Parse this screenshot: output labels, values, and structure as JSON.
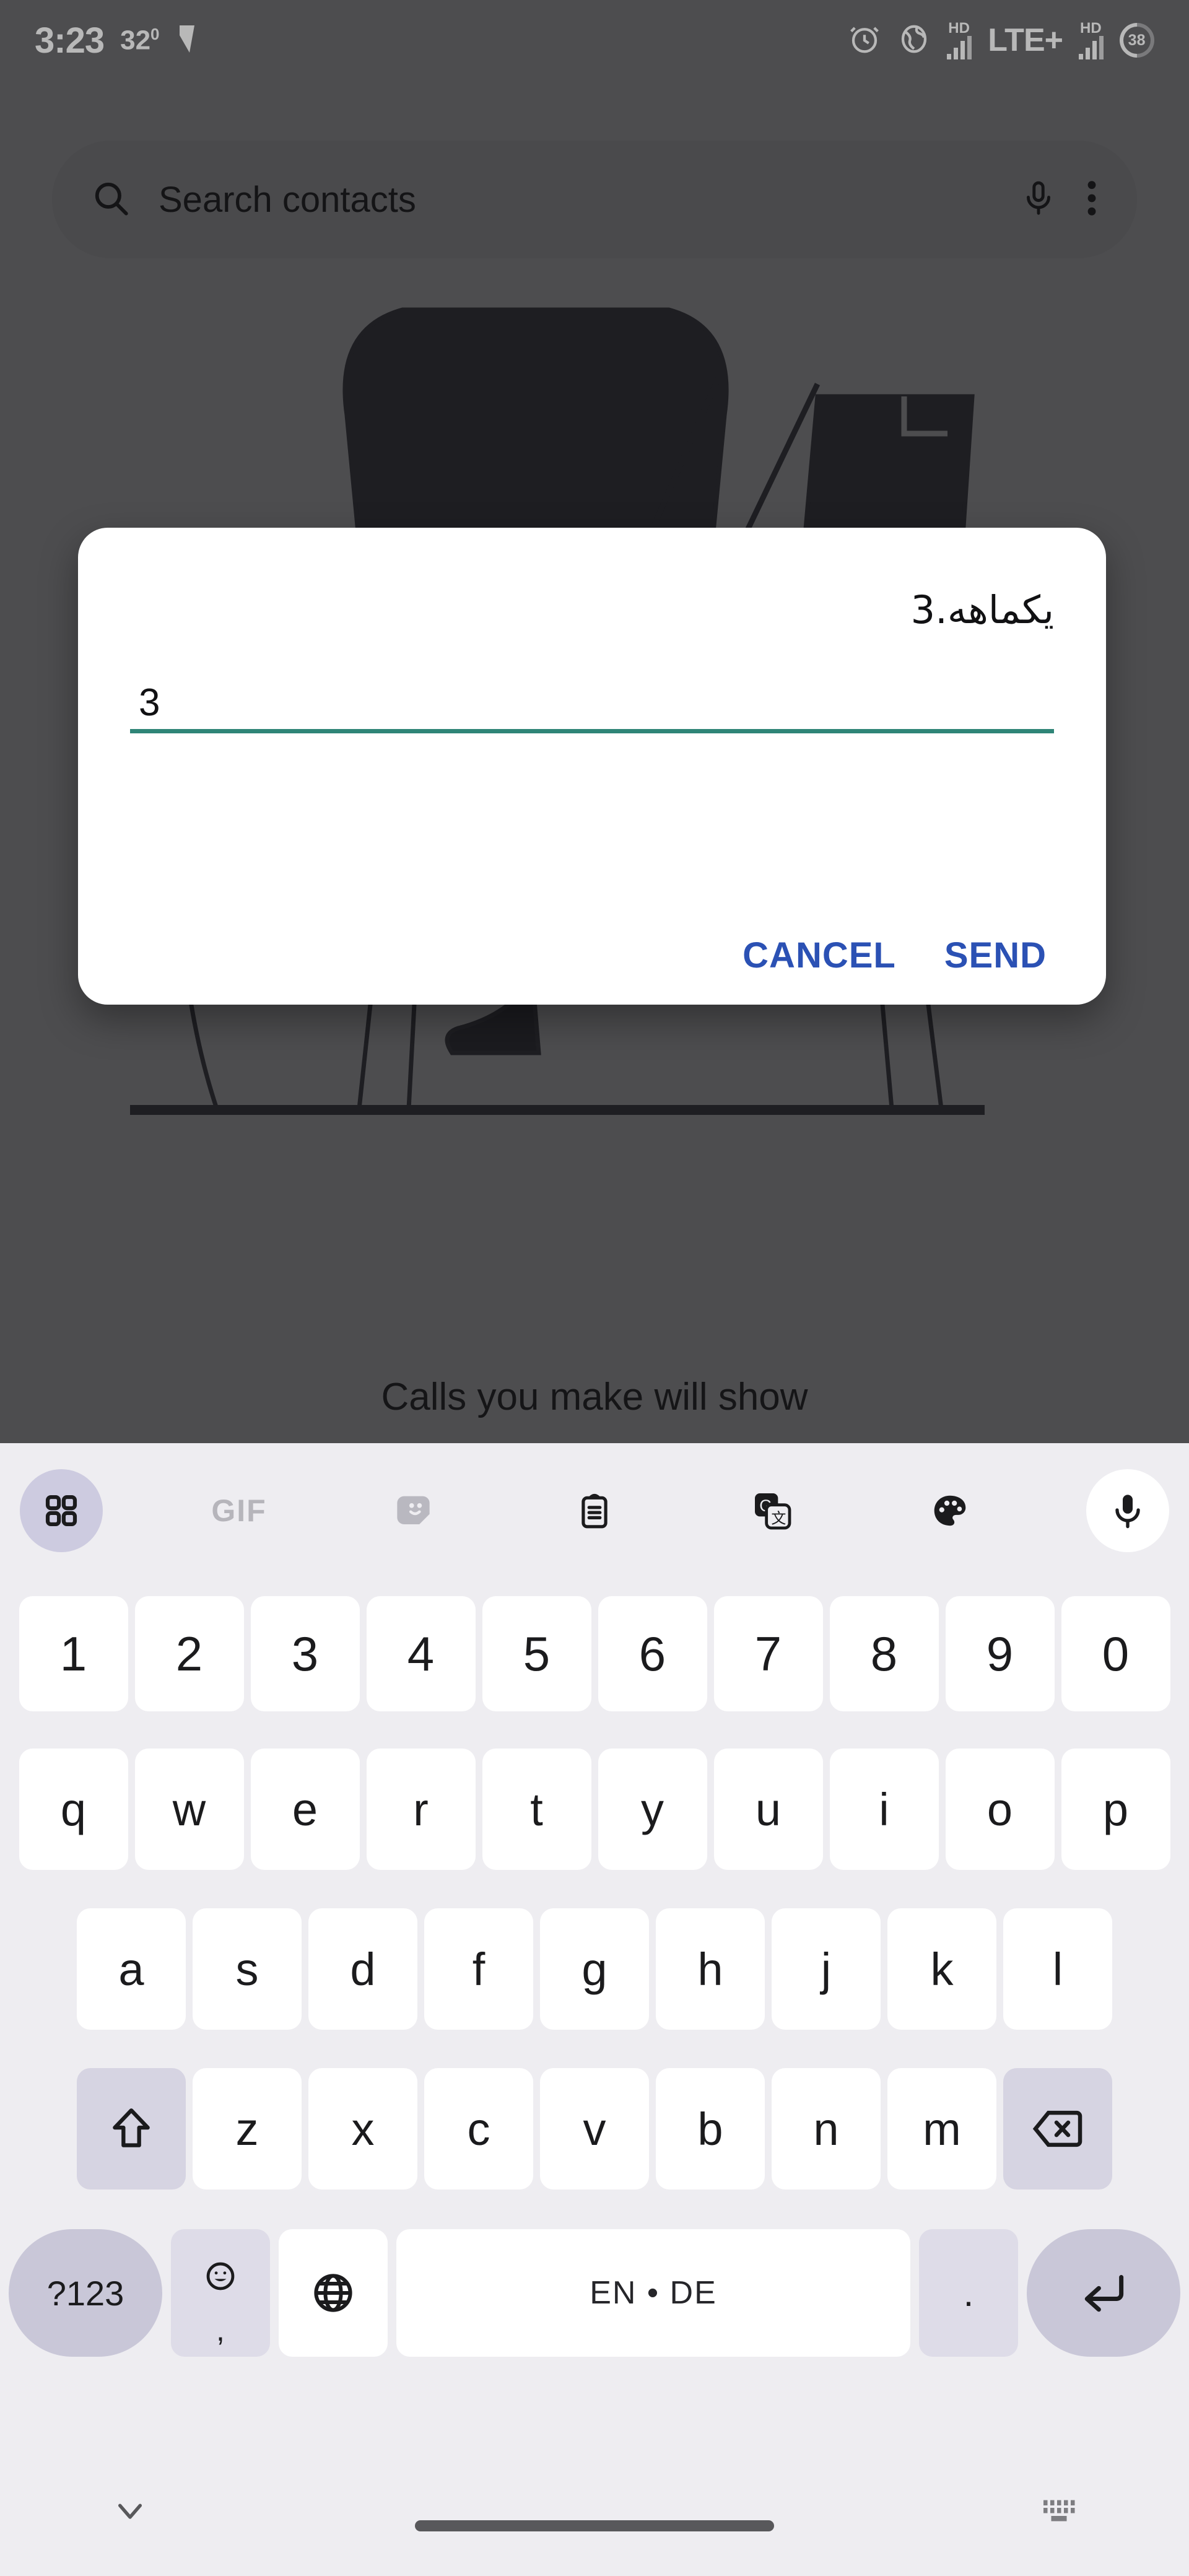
{
  "status_bar": {
    "clock": "3:23",
    "temperature": "32",
    "temperature_unit": "0",
    "left_icons": [
      "checkmark-sent-icon"
    ],
    "network_label": "LTE+",
    "hd_label_1": "HD",
    "hd_label_2": "HD",
    "battery_percent": "38",
    "right_icons": [
      "alarm-clock-icon",
      "globe-vpn-icon",
      "signal-bars-icon",
      "signal-bars-icon",
      "battery-icon"
    ]
  },
  "search": {
    "placeholder": "Search contacts",
    "value": "",
    "icons": [
      "search-icon",
      "microphone-icon",
      "overflow-menu-icon"
    ]
  },
  "empty_state": {
    "text": "Calls you make will show",
    "illustration": "person-sitting-in-chair-line-art"
  },
  "dialog": {
    "title": "یکماهه.3",
    "input_value": "3",
    "input_placeholder": "",
    "underline_color": "#2f8577",
    "buttons": [
      {
        "label": "CANCEL",
        "name": "cancel-button"
      },
      {
        "label": "SEND",
        "name": "send-button"
      }
    ],
    "button_color": "#2b51b4"
  },
  "keyboard": {
    "toolbar": [
      {
        "name": "keyboard-toolbar-grid-icon",
        "label": "",
        "icon": "grid-four-dots-icon"
      },
      {
        "name": "keyboard-toolbar-gif",
        "label": "GIF",
        "icon": "gif-icon"
      },
      {
        "name": "keyboard-toolbar-sticker",
        "label": "",
        "icon": "sticker-icon"
      },
      {
        "name": "keyboard-toolbar-clipboard",
        "label": "",
        "icon": "clipboard-icon"
      },
      {
        "name": "keyboard-toolbar-translate",
        "label": "",
        "icon": "translate-icon"
      },
      {
        "name": "keyboard-toolbar-theme",
        "label": "",
        "icon": "palette-icon"
      },
      {
        "name": "keyboard-toolbar-voice",
        "label": "",
        "icon": "microphone-icon"
      }
    ],
    "row_numbers": [
      "1",
      "2",
      "3",
      "4",
      "5",
      "6",
      "7",
      "8",
      "9",
      "0"
    ],
    "row_top": [
      "q",
      "w",
      "e",
      "r",
      "t",
      "y",
      "u",
      "i",
      "o",
      "p"
    ],
    "row_home": [
      "a",
      "s",
      "d",
      "f",
      "g",
      "h",
      "j",
      "k",
      "l"
    ],
    "row_bottom": [
      "z",
      "x",
      "c",
      "v",
      "b",
      "n",
      "m"
    ],
    "shift_label": "",
    "backspace_label": "",
    "symbols_label": "?123",
    "emoji_label": "",
    "comma_label": ",",
    "globe_label": "",
    "space_label": "EN • DE",
    "period_label": ".",
    "enter_label": ""
  },
  "nav_bar": {
    "hide_keyboard_icon": "chevron-down-icon",
    "gesture_pill": "home-gesture-pill",
    "switch_keyboard_icon": "keyboard-switch-icon"
  },
  "colors": {
    "scrim": "#6b6b6e",
    "keyboard_bg": "#eeedf1",
    "key_bg": "#ffffff",
    "key_mod_bg": "#d6d4e2",
    "accent_blue": "#2b51b4",
    "accent_teal": "#2f8577"
  }
}
